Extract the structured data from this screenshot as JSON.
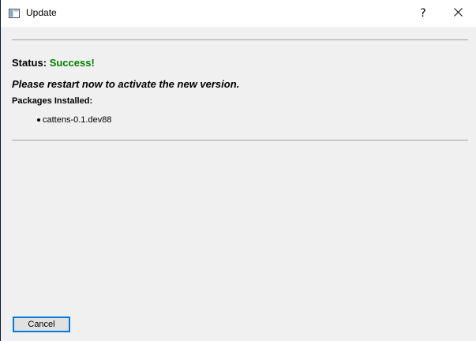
{
  "window": {
    "title": "Update",
    "icon": "app-window-icon",
    "controls": {
      "help_label": "?",
      "close_icon": "close-icon"
    }
  },
  "status": {
    "label": "Status:",
    "value": "Success!",
    "value_color": "#008000"
  },
  "message": "Please restart now to activate the new version.",
  "packages": {
    "label": "Packages Installed:",
    "items": [
      "cattens-0.1.dev88"
    ]
  },
  "buttons": {
    "cancel_label": "Cancel"
  },
  "colors": {
    "focus_border": "#0078d7",
    "background": "#f0f0f0"
  }
}
